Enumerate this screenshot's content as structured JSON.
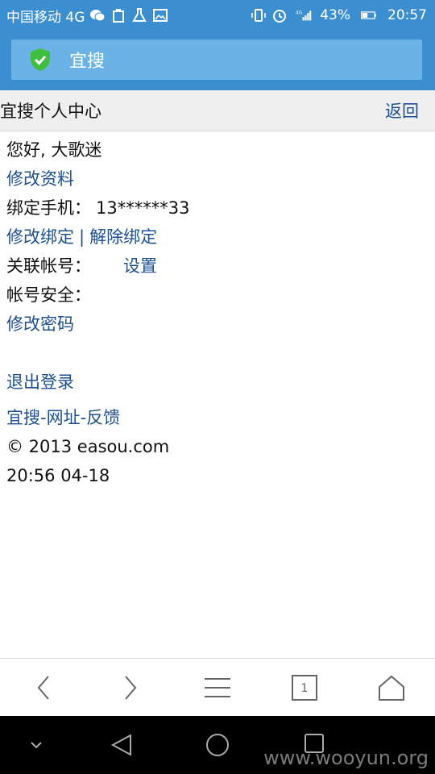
{
  "status_bar": {
    "carrier": "中国移动 4G",
    "battery": "43%",
    "time": "20:57",
    "net_label": "4G"
  },
  "app_bar": {
    "title": "宜搜"
  },
  "page_bar": {
    "title": "宜搜个人中心",
    "back": "返回"
  },
  "content": {
    "greeting": "您好, 大歌迷",
    "edit_profile": "修改资料",
    "bind_phone_label": "绑定手机：",
    "bind_phone_value": "13******33",
    "modify_binding": "修改绑定",
    "separator": "|",
    "remove_binding": "解除绑定",
    "linked_accounts_label": "关联帐号：",
    "linked_accounts_action": "设置",
    "account_security_label": "帐号安全：",
    "change_password": "修改密码",
    "logout": "退出登录",
    "footer_links": "宜搜-网址-反馈",
    "copyright": "© 2013 easou.com",
    "datetime": "20:56 04-18"
  },
  "toolbar": {
    "tab_count": "1"
  },
  "watermark": "www.wooyun.org",
  "colors": {
    "status_blue": "#3b8fd0",
    "link_blue": "#1d4f91",
    "shield_green": "#3fbf3f"
  }
}
